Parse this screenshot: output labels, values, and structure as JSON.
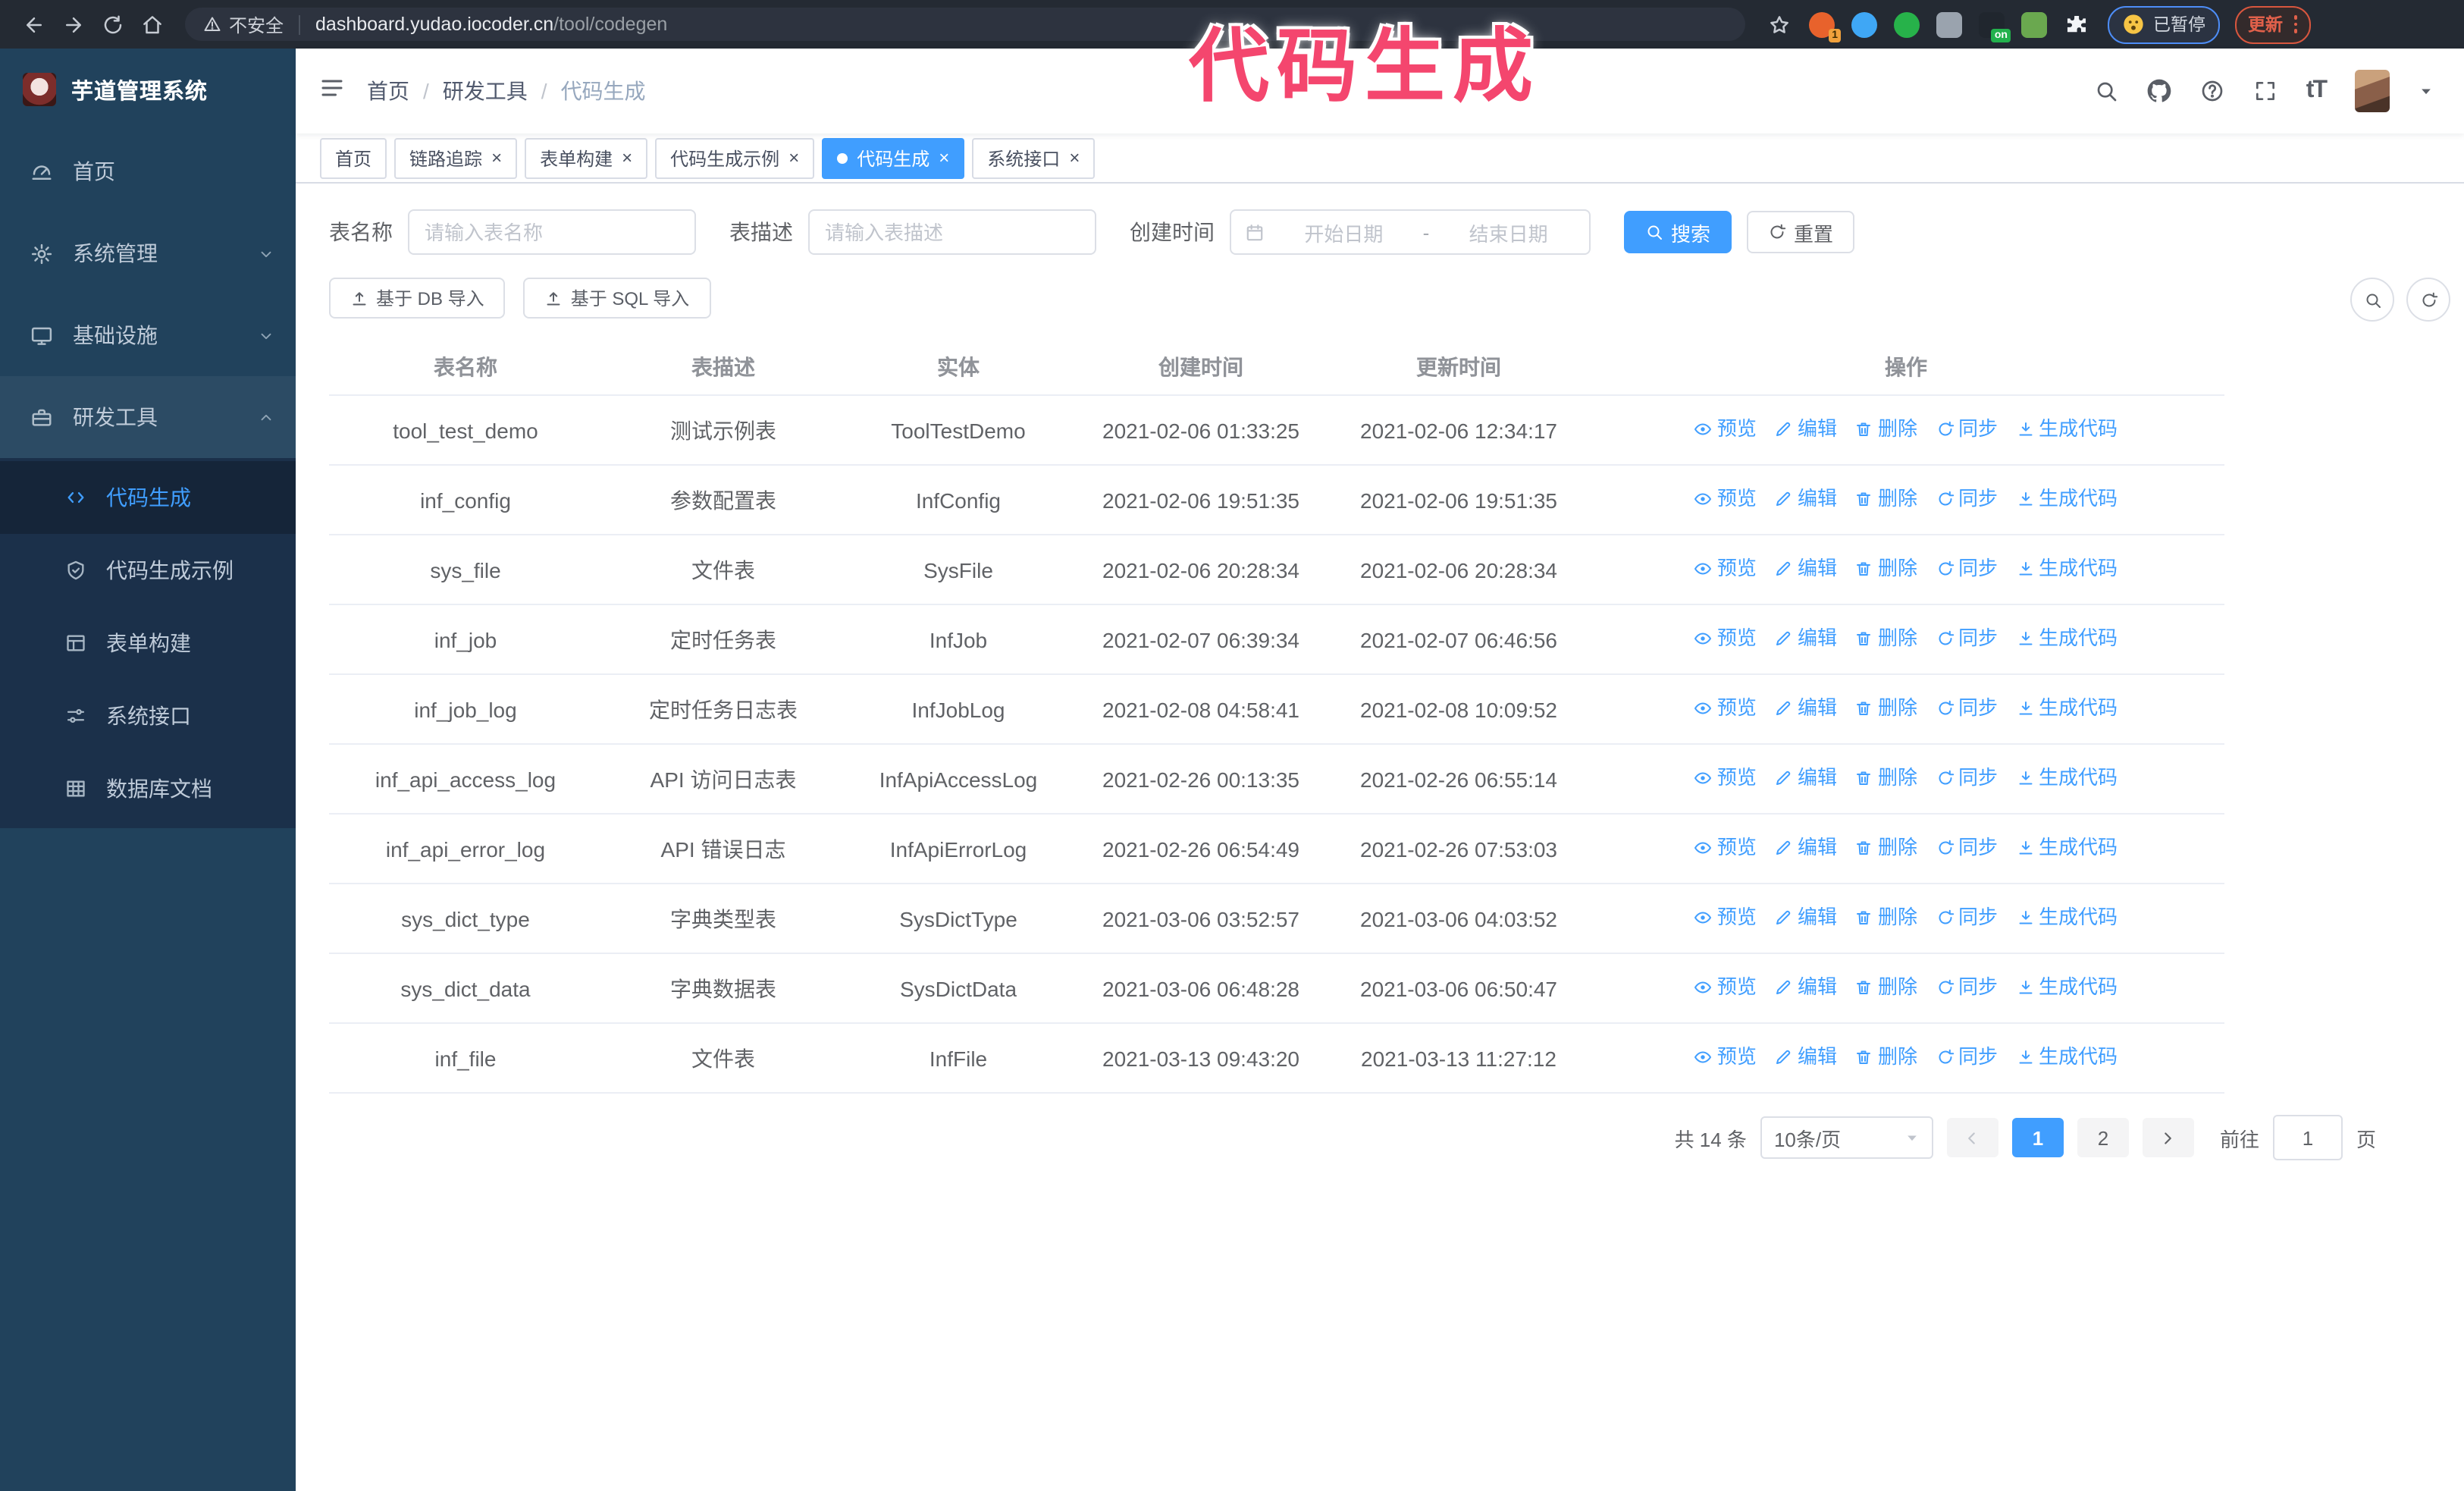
{
  "colors": {
    "accent": "#409eff",
    "sidebar_bg": "#21425c",
    "submenu_bg": "#1b304a",
    "annotation_pink": "#f4466e",
    "chrome_bg": "#242a33"
  },
  "annotation": {
    "text": "代码生成"
  },
  "browser": {
    "security_label": "不安全",
    "url_host": "dashboard.yudao.iocoder.cn",
    "url_path": "/tool/codegen",
    "paused_badge": "已暂停",
    "update_button": "更新",
    "extensions": [
      {
        "name": "extension-orange-icon",
        "color": "#e8622c",
        "shape": "circle",
        "badge": "1"
      },
      {
        "name": "extension-gem-icon",
        "color": "#3fa7f5",
        "shape": "circle",
        "badge": ""
      },
      {
        "name": "extension-green-check-icon",
        "color": "#27b24a",
        "shape": "circle",
        "badge": ""
      },
      {
        "name": "extension-squares-icon",
        "color": "#9aa3ae",
        "shape": "square",
        "badge": ""
      },
      {
        "name": "extension-dark-icon",
        "color": "#20262e",
        "shape": "square",
        "badge": "on"
      },
      {
        "name": "extension-leaf-icon",
        "color": "#6aa84f",
        "shape": "square",
        "badge": ""
      },
      {
        "name": "extension-puzzle-icon",
        "color": "#f2f4f7",
        "shape": "puzzle",
        "badge": ""
      }
    ]
  },
  "sidebar": {
    "logo_title": "芋道管理系统",
    "items": [
      {
        "label": "首页",
        "icon": "dashboard-icon"
      },
      {
        "label": "系统管理",
        "icon": "gear-icon",
        "chevron": "down"
      },
      {
        "label": "基础设施",
        "icon": "monitor-icon",
        "chevron": "down"
      },
      {
        "label": "研发工具",
        "icon": "toolbox-icon",
        "chevron": "up",
        "expanded": true
      }
    ],
    "submenu": [
      {
        "label": "代码生成",
        "icon": "code-icon",
        "active": true
      },
      {
        "label": "代码生成示例",
        "icon": "shield-check-icon"
      },
      {
        "label": "表单构建",
        "icon": "form-icon"
      },
      {
        "label": "系统接口",
        "icon": "sliders-icon"
      },
      {
        "label": "数据库文档",
        "icon": "table-grid-icon"
      }
    ]
  },
  "header": {
    "breadcrumb": [
      "首页",
      "研发工具",
      "代码生成"
    ]
  },
  "tabs": [
    {
      "label": "首页",
      "closable": false,
      "active": false
    },
    {
      "label": "链路追踪",
      "closable": true,
      "active": false
    },
    {
      "label": "表单构建",
      "closable": true,
      "active": false
    },
    {
      "label": "代码生成示例",
      "closable": true,
      "active": false
    },
    {
      "label": "代码生成",
      "closable": true,
      "active": true
    },
    {
      "label": "系统接口",
      "closable": true,
      "active": false
    }
  ],
  "filters": {
    "name_label": "表名称",
    "name_placeholder": "请输入表名称",
    "desc_label": "表描述",
    "desc_placeholder": "请输入表描述",
    "date_label": "创建时间",
    "date_start": "开始日期",
    "date_separator": "-",
    "date_end": "结束日期",
    "search_label": "搜索",
    "reset_label": "重置"
  },
  "toolbar": {
    "import_db_label": "基于 DB 导入",
    "import_sql_label": "基于 SQL 导入"
  },
  "table": {
    "columns": [
      "表名称",
      "表描述",
      "实体",
      "创建时间",
      "更新时间",
      "操作"
    ],
    "actions": [
      {
        "label": "预览",
        "icon": "eye-icon",
        "name": "preview-action"
      },
      {
        "label": "编辑",
        "icon": "edit-icon",
        "name": "edit-action"
      },
      {
        "label": "删除",
        "icon": "trash-icon",
        "name": "delete-action"
      },
      {
        "label": "同步",
        "icon": "sync-icon",
        "name": "sync-action"
      },
      {
        "label": "生成代码",
        "icon": "download-icon",
        "name": "generate-code-action"
      }
    ],
    "rows": [
      {
        "name": "tool_test_demo",
        "desc": "测试示例表",
        "entity": "ToolTestDemo",
        "created": "2021-02-06 01:33:25",
        "updated": "2021-02-06 12:34:17"
      },
      {
        "name": "inf_config",
        "desc": "参数配置表",
        "entity": "InfConfig",
        "created": "2021-02-06 19:51:35",
        "updated": "2021-02-06 19:51:35"
      },
      {
        "name": "sys_file",
        "desc": "文件表",
        "entity": "SysFile",
        "created": "2021-02-06 20:28:34",
        "updated": "2021-02-06 20:28:34"
      },
      {
        "name": "inf_job",
        "desc": "定时任务表",
        "entity": "InfJob",
        "created": "2021-02-07 06:39:34",
        "updated": "2021-02-07 06:46:56"
      },
      {
        "name": "inf_job_log",
        "desc": "定时任务日志表",
        "entity": "InfJobLog",
        "created": "2021-02-08 04:58:41",
        "updated": "2021-02-08 10:09:52"
      },
      {
        "name": "inf_api_access_log",
        "desc": "API 访问日志表",
        "entity": "InfApiAccessLog",
        "created": "2021-02-26 00:13:35",
        "updated": "2021-02-26 06:55:14"
      },
      {
        "name": "inf_api_error_log",
        "desc": "API 错误日志",
        "entity": "InfApiErrorLog",
        "created": "2021-02-26 06:54:49",
        "updated": "2021-02-26 07:53:03"
      },
      {
        "name": "sys_dict_type",
        "desc": "字典类型表",
        "entity": "SysDictType",
        "created": "2021-03-06 03:52:57",
        "updated": "2021-03-06 04:03:52"
      },
      {
        "name": "sys_dict_data",
        "desc": "字典数据表",
        "entity": "SysDictData",
        "created": "2021-03-06 06:48:28",
        "updated": "2021-03-06 06:50:47"
      },
      {
        "name": "inf_file",
        "desc": "文件表",
        "entity": "InfFile",
        "created": "2021-03-13 09:43:20",
        "updated": "2021-03-13 11:27:12"
      }
    ]
  },
  "pagination": {
    "total_text": "共 14 条",
    "page_size": "10条/页",
    "pages": [
      "1",
      "2"
    ],
    "active_page": "1",
    "goto_label": "前往",
    "goto_value": "1",
    "goto_unit": "页"
  }
}
